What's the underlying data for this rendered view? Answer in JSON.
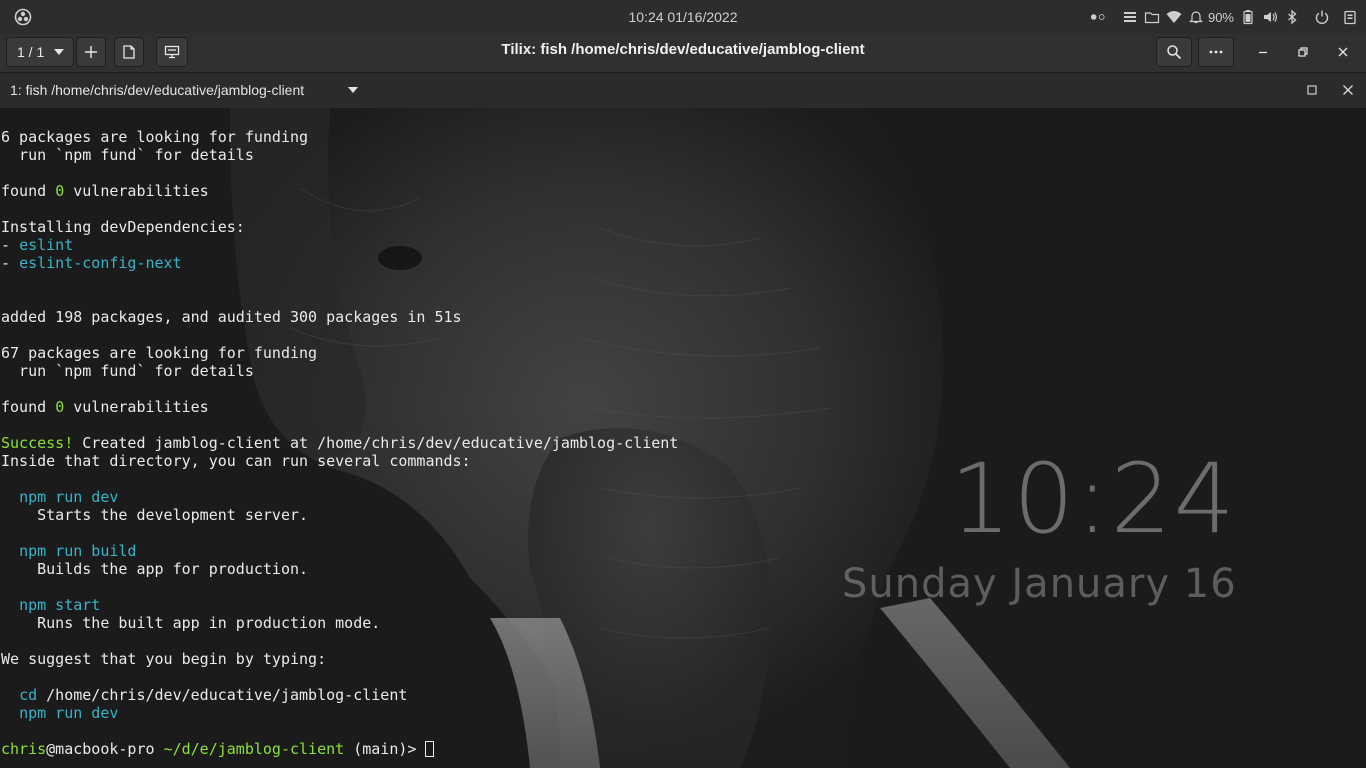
{
  "topbar": {
    "clock": "10:24 01/16/2022",
    "battery_pct": "90%",
    "icons": [
      "activities-icon",
      "toggle-indicator-icon",
      "menu-icon",
      "folder-icon",
      "wifi-icon",
      "notification-bell-icon",
      "battery-icon",
      "volume-icon",
      "bluetooth-icon",
      "power-icon",
      "clipboard-icon"
    ]
  },
  "headerbar": {
    "session_counter": "1 / 1",
    "title": "Tilix: fish /home/chris/dev/educative/jamblog-client"
  },
  "session": {
    "title": "1: fish /home/chris/dev/educative/jamblog-client"
  },
  "terminal": {
    "lines": [
      [
        {
          "t": "6 packages are looking for funding"
        }
      ],
      [
        {
          "t": "  run `npm fund` for details"
        }
      ],
      [],
      [
        {
          "t": "found "
        },
        {
          "t": "0",
          "c": "green"
        },
        {
          "t": " vulnerabilities"
        }
      ],
      [],
      [
        {
          "t": "Installing devDependencies:"
        }
      ],
      [
        {
          "t": "- "
        },
        {
          "t": "eslint",
          "c": "cyan"
        }
      ],
      [
        {
          "t": "- "
        },
        {
          "t": "eslint-config-next",
          "c": "cyan"
        }
      ],
      [],
      [],
      [
        {
          "t": "added 198 packages, and audited 300 packages in 51s"
        }
      ],
      [],
      [
        {
          "t": "67 packages are looking for funding"
        }
      ],
      [
        {
          "t": "  run `npm fund` for details"
        }
      ],
      [],
      [
        {
          "t": "found "
        },
        {
          "t": "0",
          "c": "green"
        },
        {
          "t": " vulnerabilities"
        }
      ],
      [],
      [
        {
          "t": "Success!",
          "c": "green"
        },
        {
          "t": " Created jamblog-client at /home/chris/dev/educative/jamblog-client"
        }
      ],
      [
        {
          "t": "Inside that directory, you can run several commands:"
        }
      ],
      [],
      [
        {
          "t": "  "
        },
        {
          "t": "npm run dev",
          "c": "cyan"
        }
      ],
      [
        {
          "t": "    Starts the development server."
        }
      ],
      [],
      [
        {
          "t": "  "
        },
        {
          "t": "npm run build",
          "c": "cyan"
        }
      ],
      [
        {
          "t": "    Builds the app for production."
        }
      ],
      [],
      [
        {
          "t": "  "
        },
        {
          "t": "npm start",
          "c": "cyan"
        }
      ],
      [
        {
          "t": "    Runs the built app in production mode."
        }
      ],
      [],
      [
        {
          "t": "We suggest that you begin by typing:"
        }
      ],
      [],
      [
        {
          "t": "  "
        },
        {
          "t": "cd",
          "c": "cyan"
        },
        {
          "t": " /home/chris/dev/educative/jamblog-client"
        }
      ],
      [
        {
          "t": "  "
        },
        {
          "t": "npm run dev",
          "c": "cyan"
        }
      ],
      [],
      [
        {
          "t": "chris",
          "c": "lime"
        },
        {
          "t": "@macbook-pro "
        },
        {
          "t": "~/d/e/jamblog-client",
          "c": "lime"
        },
        {
          "t": " (main)> "
        },
        {
          "cursor": true
        }
      ]
    ]
  },
  "wallpaper": {
    "time": "10:24",
    "date": "Sunday January 16"
  }
}
